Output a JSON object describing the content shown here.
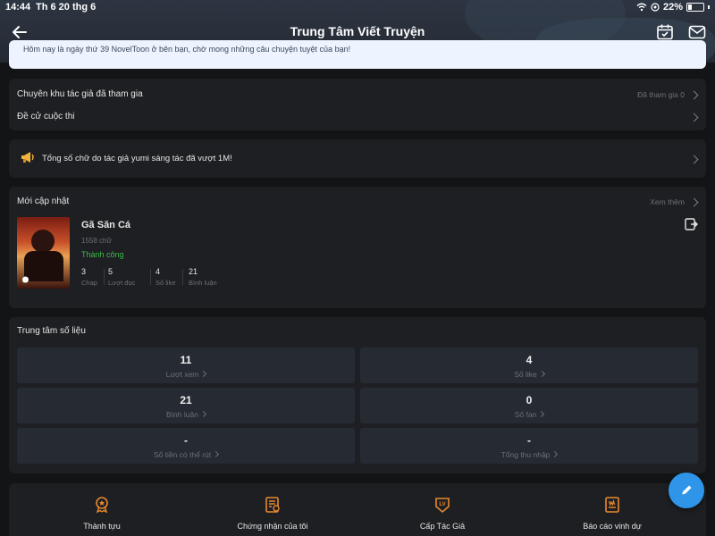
{
  "status_bar": {
    "time": "14:44",
    "date": "Th 6 20 thg 6",
    "battery": "22%"
  },
  "header": {
    "title": "Trung Tâm Viết Truyện",
    "banner_text": "Hôm nay là ngày thứ 39 NovelToon ở bên bạn, chờ mong những câu chuyện tuyệt của bạn!"
  },
  "menu": {
    "zone_label": "Chuyên khu tác giả đã tham gia",
    "zone_meta": "Đã tham gia 0",
    "contest_label": "Đề cử cuộc thi"
  },
  "announcement": {
    "text": "Tổng số chữ do tác giả yumi sáng tác đã vượt 1M!"
  },
  "recent": {
    "title": "Mới cập nhật",
    "see_more": "Xem thêm",
    "story": {
      "name": "Gã Săn Cá",
      "word_count": "1558 chữ",
      "status": "Thành công",
      "stats": [
        {
          "value": "3",
          "label": "Chap"
        },
        {
          "value": "5",
          "label": "Lượt đọc"
        },
        {
          "value": "4",
          "label": "Số like"
        },
        {
          "value": "21",
          "label": "Bình luận"
        }
      ]
    }
  },
  "data_center": {
    "title": "Trung tâm số liệu",
    "stats": [
      {
        "value": "11",
        "label": "Lượt xem"
      },
      {
        "value": "4",
        "label": "Số like"
      },
      {
        "value": "21",
        "label": "Bình luận"
      },
      {
        "value": "0",
        "label": "Số fan"
      },
      {
        "value": "-",
        "label": "Số tiền có thể rút"
      },
      {
        "value": "-",
        "label": "Tổng thu nhập"
      }
    ]
  },
  "bottom_nav": [
    {
      "label": "Thành tựu",
      "icon": "medal-icon"
    },
    {
      "label": "Chứng nhận của tôi",
      "icon": "certificate-icon"
    },
    {
      "label": "Cấp Tác Giả",
      "icon": "author-level-icon"
    },
    {
      "label": "Báo cáo vinh dự",
      "icon": "honor-report-icon"
    }
  ],
  "colors": {
    "accent_orange": "#e8892e",
    "success_green": "#3cbc4a",
    "fab_blue": "#2f95e8"
  }
}
